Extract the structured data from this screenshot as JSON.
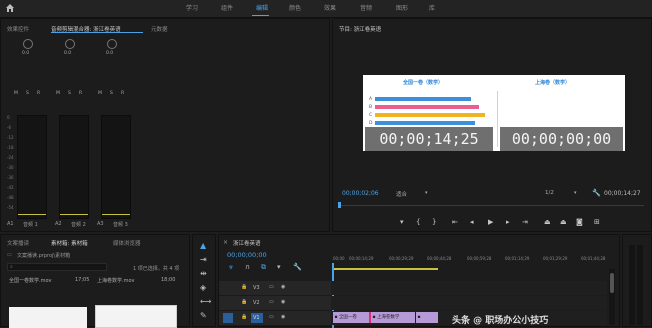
{
  "workspaces": [
    "学习",
    "组件",
    "编辑",
    "颜色",
    "效果",
    "音频",
    "图形",
    "库"
  ],
  "active_workspace_index": 2,
  "mixer_panel": {
    "tabs": [
      "效果控件",
      "音频剪辑混合器: 浙江卷英语",
      "元数据"
    ],
    "channels": [
      {
        "pan": "0.0",
        "knob_label": "L",
        "ch": "A1",
        "name": "音频 1"
      },
      {
        "pan": "0.0",
        "knob_label": "L",
        "ch": "A2",
        "name": "音频 2"
      },
      {
        "pan": "0.0",
        "knob_label": "L",
        "ch": "A3",
        "name": "音频 3"
      }
    ],
    "msr": [
      "M",
      "S",
      "R"
    ],
    "scale": [
      "0",
      "-6",
      "-12",
      "-18",
      "-24",
      "-30",
      "-36",
      "-42",
      "-48",
      "-54",
      "dB"
    ]
  },
  "program_monitor": {
    "title": "节目: 浙江卷英语",
    "left_heading": "全国一卷（数学）",
    "right_heading": "上海卷（数学）",
    "row_labels": [
      "A",
      "B",
      "C",
      "D"
    ],
    "bar_colors": [
      "#3c8fd8",
      "#ea5f8e",
      "#f0b321",
      "#3c8fd8"
    ],
    "left_timecode": "00;00;14;25",
    "right_timecode": "00;00;00;00",
    "current_time": "00;00;02;06",
    "fit_label": "适合",
    "quality_label": "1/2",
    "duration": "00;00;14;27"
  },
  "project_panel": {
    "tabs": [
      "文案播读",
      "素材箱: 素材箱",
      "媒体浏览器"
    ],
    "path": "文案播读.prproj\\素材箱",
    "selection_info": "1 项已选择，共 4 项",
    "items": [
      {
        "name": "全国一卷数学.mov",
        "duration": "17;05"
      },
      {
        "name": "上海卷数学.mov",
        "duration": "18;00"
      }
    ]
  },
  "timeline": {
    "title": "浙江卷英语",
    "timecode": "00;00;00;00",
    "ruler": [
      "00;00",
      "00;00;14;29",
      "00;00;29;29",
      "00;00;44;28",
      "00;00;59;28",
      "00;01;14;29",
      "00;01;29;29",
      "00;01;44;28"
    ],
    "tracks": [
      "V3",
      "V2",
      "V1"
    ],
    "clips": [
      {
        "label": "全国一卷"
      },
      {
        "label": "上海卷数学"
      },
      {
        "label": ""
      }
    ]
  },
  "watermark": "头条 @ 职场办公小技巧"
}
